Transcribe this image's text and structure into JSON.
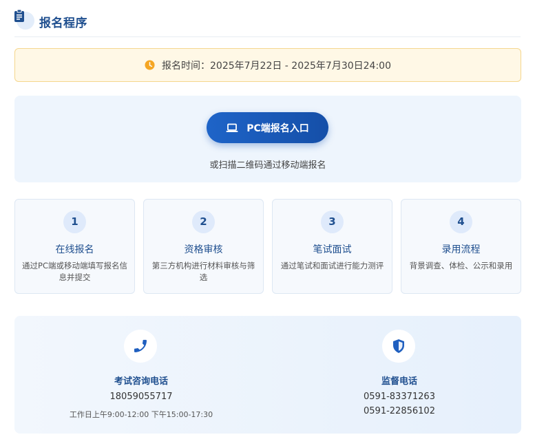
{
  "header": {
    "title": "报名程序",
    "icon": "clipboard-icon"
  },
  "registration_time": {
    "label": "报名时间：2025年7月22日 - 2025年7月30日24:00",
    "icon": "clock-icon"
  },
  "entry": {
    "pc_button_label": "PC端报名入口",
    "pc_button_icon": "laptop-icon",
    "qr_hint": "或扫描二维码通过移动端报名"
  },
  "steps": [
    {
      "number": "1",
      "title": "在线报名",
      "desc": "通过PC端或移动端填写报名信息并提交"
    },
    {
      "number": "2",
      "title": "资格审核",
      "desc": "第三方机构进行材料审核与筛选"
    },
    {
      "number": "3",
      "title": "笔试面试",
      "desc": "通过笔试和面试进行能力测评"
    },
    {
      "number": "4",
      "title": "录用流程",
      "desc": "背景调查、体检、公示和录用"
    }
  ],
  "contacts": {
    "consult": {
      "icon": "phone-icon",
      "title": "考试咨询电话",
      "phone": "18059055717",
      "hours": "工作日上午9:00-12:00 下午15:00-17:30"
    },
    "supervise": {
      "icon": "shield-icon",
      "title": "监督电话",
      "phone1": "0591-83371263",
      "phone2": "0591-22856102"
    }
  },
  "colors": {
    "accent": "#1f4f8f",
    "button": "#1e64c8",
    "warning": "#f5a623"
  }
}
